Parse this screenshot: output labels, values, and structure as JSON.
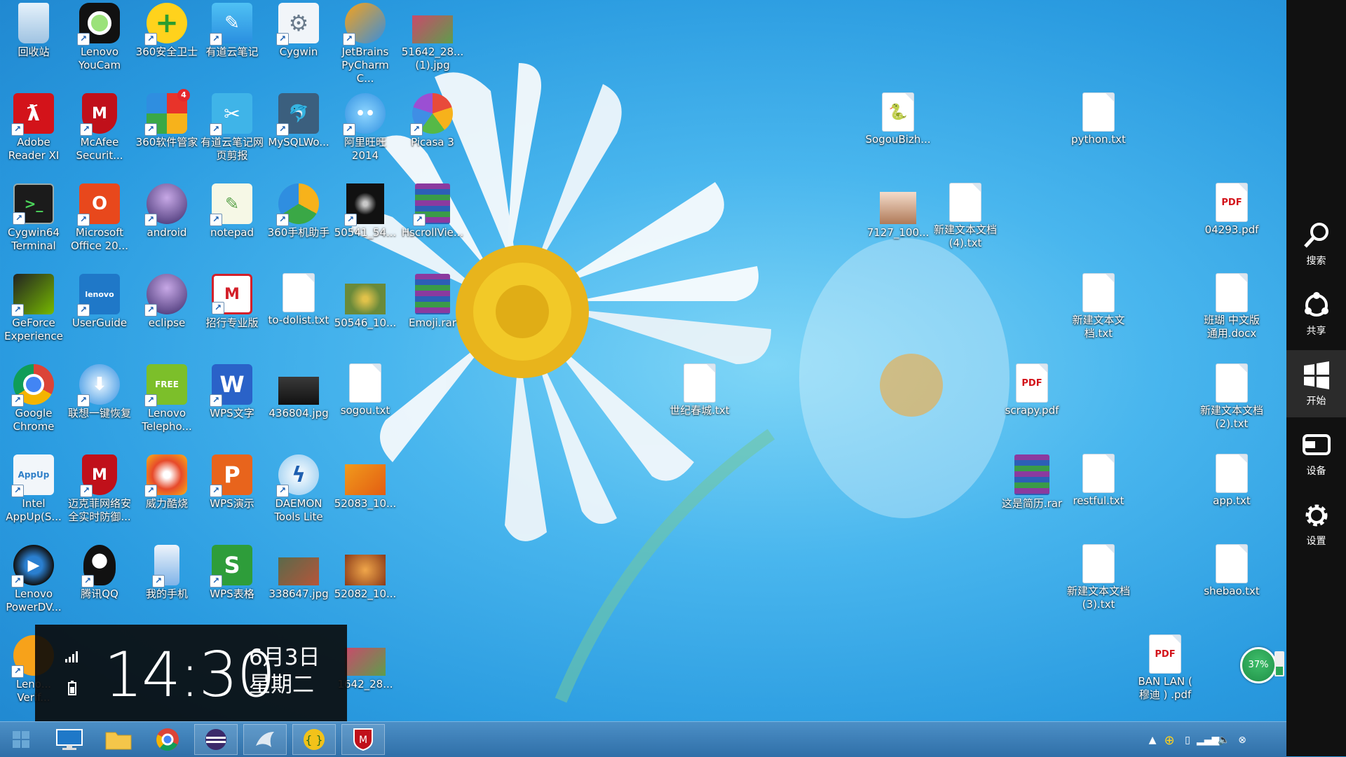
{
  "desktop": {
    "icons": [
      {
        "id": "recycle",
        "label": "回收站"
      },
      {
        "id": "lenovo-youcam",
        "label": "Lenovo YouCam"
      },
      {
        "id": "360-safe",
        "label": "360安全卫士"
      },
      {
        "id": "youdao-note",
        "label": "有道云笔记"
      },
      {
        "id": "cygwin",
        "label": "Cygwin"
      },
      {
        "id": "pycharm",
        "label": "JetBrains PyCharm C..."
      },
      {
        "id": "img-51642-1",
        "label": "51642_28... (1).jpg"
      },
      {
        "id": "adobe-reader",
        "label": "Adobe Reader XI"
      },
      {
        "id": "mcafee",
        "label": "McAfee Securit..."
      },
      {
        "id": "360-software",
        "label": "360软件管家"
      },
      {
        "id": "youdao-clip",
        "label": "有道云笔记网页剪报"
      },
      {
        "id": "mysql-wb",
        "label": "MySQLWo..."
      },
      {
        "id": "aliwangwang",
        "label": "阿里旺旺 2014"
      },
      {
        "id": "picasa",
        "label": "Picasa 3"
      },
      {
        "id": "cygwin64",
        "label": "Cygwin64 Terminal"
      },
      {
        "id": "ms-office",
        "label": "Microsoft Office 20..."
      },
      {
        "id": "android",
        "label": "android"
      },
      {
        "id": "notepad",
        "label": "notepad"
      },
      {
        "id": "360-phone",
        "label": "360手机助手"
      },
      {
        "id": "img-50541",
        "label": "50541_54..."
      },
      {
        "id": "hscroll",
        "label": "HscrollVie..."
      },
      {
        "id": "geforce",
        "label": "GeForce Experience"
      },
      {
        "id": "userguide",
        "label": "UserGuide"
      },
      {
        "id": "eclipse",
        "label": "eclipse"
      },
      {
        "id": "zhaohang",
        "label": "招行专业版"
      },
      {
        "id": "todolist",
        "label": "to-dolist.txt"
      },
      {
        "id": "img-50546",
        "label": "50546_10..."
      },
      {
        "id": "emoji-rar",
        "label": "Emoji.rar"
      },
      {
        "id": "chrome",
        "label": "Google Chrome"
      },
      {
        "id": "lenovo-recovery",
        "label": "联想一键恢复"
      },
      {
        "id": "lenovo-telephony",
        "label": "Lenovo Telepho..."
      },
      {
        "id": "wps-writer",
        "label": "WPS文字"
      },
      {
        "id": "img-436804",
        "label": "436804.jpg"
      },
      {
        "id": "sogou-txt",
        "label": "sogou.txt"
      },
      {
        "id": "intel-appup",
        "label": "Intel AppUp(S..."
      },
      {
        "id": "mcafee-web",
        "label": "迈克菲网络安全实时防御..."
      },
      {
        "id": "weili",
        "label": "威力酷烧"
      },
      {
        "id": "wps-present",
        "label": "WPS演示"
      },
      {
        "id": "daemon",
        "label": "DAEMON Tools Lite"
      },
      {
        "id": "img-52083",
        "label": "52083_10..."
      },
      {
        "id": "lenovo-powerdvd",
        "label": "Lenovo PowerDV..."
      },
      {
        "id": "qq",
        "label": "腾讯QQ"
      },
      {
        "id": "myphone",
        "label": "我的手机"
      },
      {
        "id": "wps-sheet",
        "label": "WPS表格"
      },
      {
        "id": "img-338647",
        "label": "338647.jpg"
      },
      {
        "id": "img-52082",
        "label": "52082_10..."
      },
      {
        "id": "lenovo-verify",
        "label": "Leno... Verif..."
      },
      {
        "id": "img-51642-2",
        "label": "1642_28..."
      },
      {
        "id": "shijichun",
        "label": "世纪春城.txt"
      },
      {
        "id": "sogoubizh",
        "label": "SogouBizh..."
      },
      {
        "id": "python-txt",
        "label": "python.txt"
      },
      {
        "id": "img-7127",
        "label": "7127_100..."
      },
      {
        "id": "new-txt-4",
        "label": "新建文本文档 (4).txt"
      },
      {
        "id": "pdf-04293",
        "label": "04293.pdf"
      },
      {
        "id": "new-txt",
        "label": "新建文本文档.txt"
      },
      {
        "id": "banhu-docx",
        "label": "班瑚 中文版 通用.docx"
      },
      {
        "id": "scrapy-pdf",
        "label": "scrapy.pdf"
      },
      {
        "id": "new-txt-2",
        "label": "新建文本文档 (2).txt"
      },
      {
        "id": "resume-rar",
        "label": "这是简历.rar"
      },
      {
        "id": "restful",
        "label": "restful.txt"
      },
      {
        "id": "app-txt",
        "label": "app.txt"
      },
      {
        "id": "new-txt-3",
        "label": "新建文本文档 (3).txt"
      },
      {
        "id": "shebao",
        "label": "shebao.txt"
      },
      {
        "id": "banlan-pdf",
        "label": "BAN LAN ( 穆迪 ) .pdf"
      }
    ]
  },
  "charms": {
    "search": "搜索",
    "share": "共享",
    "start": "开始",
    "devices": "设备",
    "settings": "设置"
  },
  "clock": {
    "time": "14:30",
    "date": "6月3日",
    "weekday": "星期二"
  },
  "battery": {
    "percent_label": "37%",
    "level": 0.37
  },
  "colors": {
    "charm_bar": "#111111",
    "taskbar": "#3a7fb8",
    "battery_green": "#2aa555"
  }
}
